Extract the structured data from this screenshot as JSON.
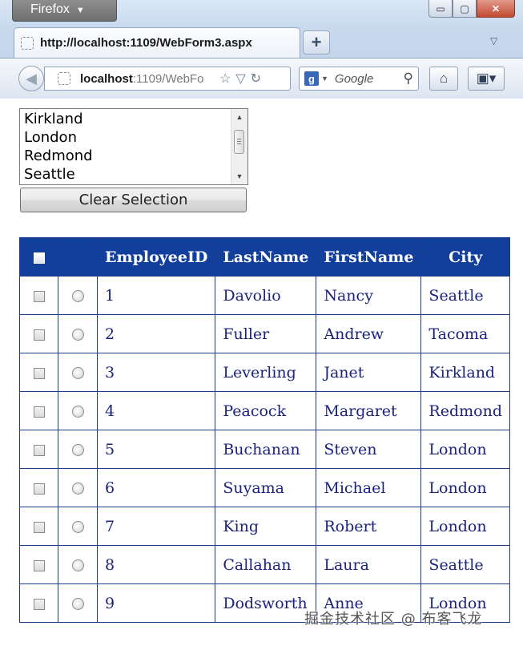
{
  "browser": {
    "app_menu_label": "Firefox",
    "window_controls": {
      "minimize": "▭",
      "maximize": "▢",
      "close": "✕"
    },
    "tab": {
      "title": "http://localhost:1109/WebForm3.aspx"
    },
    "new_tab_label": "+",
    "url": {
      "host": "localhost",
      "rest": ":1109/WebFo"
    },
    "search": {
      "engine_icon": "g",
      "placeholder": "Google"
    }
  },
  "listbox": {
    "items": [
      "Kirkland",
      "London",
      "Redmond",
      "Seattle"
    ]
  },
  "clear_button_label": "Clear Selection",
  "grid": {
    "headers": {
      "employee_id": "EmployeeID",
      "last_name": "LastName",
      "first_name": "FirstName",
      "city": "City"
    },
    "rows": [
      {
        "id": "1",
        "last": "Davolio",
        "first": "Nancy",
        "city": "Seattle"
      },
      {
        "id": "2",
        "last": "Fuller",
        "first": "Andrew",
        "city": "Tacoma"
      },
      {
        "id": "3",
        "last": "Leverling",
        "first": "Janet",
        "city": "Kirkland"
      },
      {
        "id": "4",
        "last": "Peacock",
        "first": "Margaret",
        "city": "Redmond"
      },
      {
        "id": "5",
        "last": "Buchanan",
        "first": "Steven",
        "city": "London"
      },
      {
        "id": "6",
        "last": "Suyama",
        "first": "Michael",
        "city": "London"
      },
      {
        "id": "7",
        "last": "King",
        "first": "Robert",
        "city": "London"
      },
      {
        "id": "8",
        "last": "Callahan",
        "first": "Laura",
        "city": "Seattle"
      },
      {
        "id": "9",
        "last": "Dodsworth",
        "first": "Anne",
        "city": "London"
      }
    ]
  },
  "watermark": "掘金技术社区 @ 布客飞龙",
  "colors": {
    "grid_header": "#123e9c",
    "grid_text": "#1a237e",
    "grid_border": "#1e3a8a"
  }
}
